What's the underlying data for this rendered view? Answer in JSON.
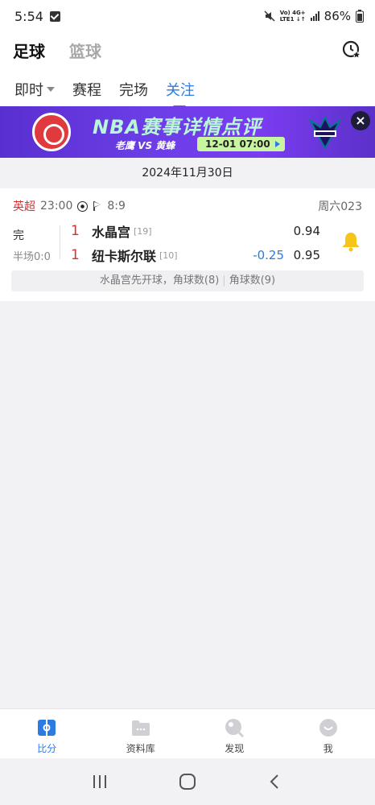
{
  "status_bar": {
    "time": "5:54",
    "network_top": "Vo) 4G+",
    "network_bottom": "LTE1 ↓↑",
    "battery": "86%"
  },
  "top_tabs": [
    {
      "label": "足球",
      "active": true
    },
    {
      "label": "篮球",
      "active": false
    }
  ],
  "sub_tabs": [
    {
      "label": "即时",
      "active": false,
      "has_dropdown": true
    },
    {
      "label": "赛程",
      "active": false
    },
    {
      "label": "完场",
      "active": false
    },
    {
      "label": "关注",
      "active": true
    }
  ],
  "banner": {
    "title": "NBA赛事详情点评",
    "subtitle": "老鹰 VS 黄蜂",
    "time": "12-01 07:00",
    "close_symbol": "×"
  },
  "date": "2024年11月30日",
  "match": {
    "league": "英超",
    "kickoff": "23:00",
    "corners": "8:9",
    "weekday_code": "周六023",
    "status": "完",
    "half_time": "半场0:0",
    "home": {
      "score": "1",
      "name": "水晶宫",
      "rank": "[19]",
      "odds": "0.94"
    },
    "away": {
      "score": "1",
      "name": "纽卡斯尔联",
      "rank": "[10]",
      "handicap": "-0.25",
      "odds": "0.95"
    },
    "note_parts": [
      "水晶宫先开球，角球数(8)",
      "角球数(9)"
    ],
    "note_separator": "|"
  },
  "bottom_nav": [
    {
      "label": "比分",
      "icon": "scoreboard-icon",
      "active": true
    },
    {
      "label": "资料库",
      "icon": "folder-icon",
      "active": false
    },
    {
      "label": "发现",
      "icon": "discover-icon",
      "active": false
    },
    {
      "label": "我",
      "icon": "profile-icon",
      "active": false
    }
  ],
  "colors": {
    "accent": "#2b7be4",
    "score_red": "#d83030",
    "bell": "#f5c518",
    "banner_purple": "#6b3ee6"
  }
}
